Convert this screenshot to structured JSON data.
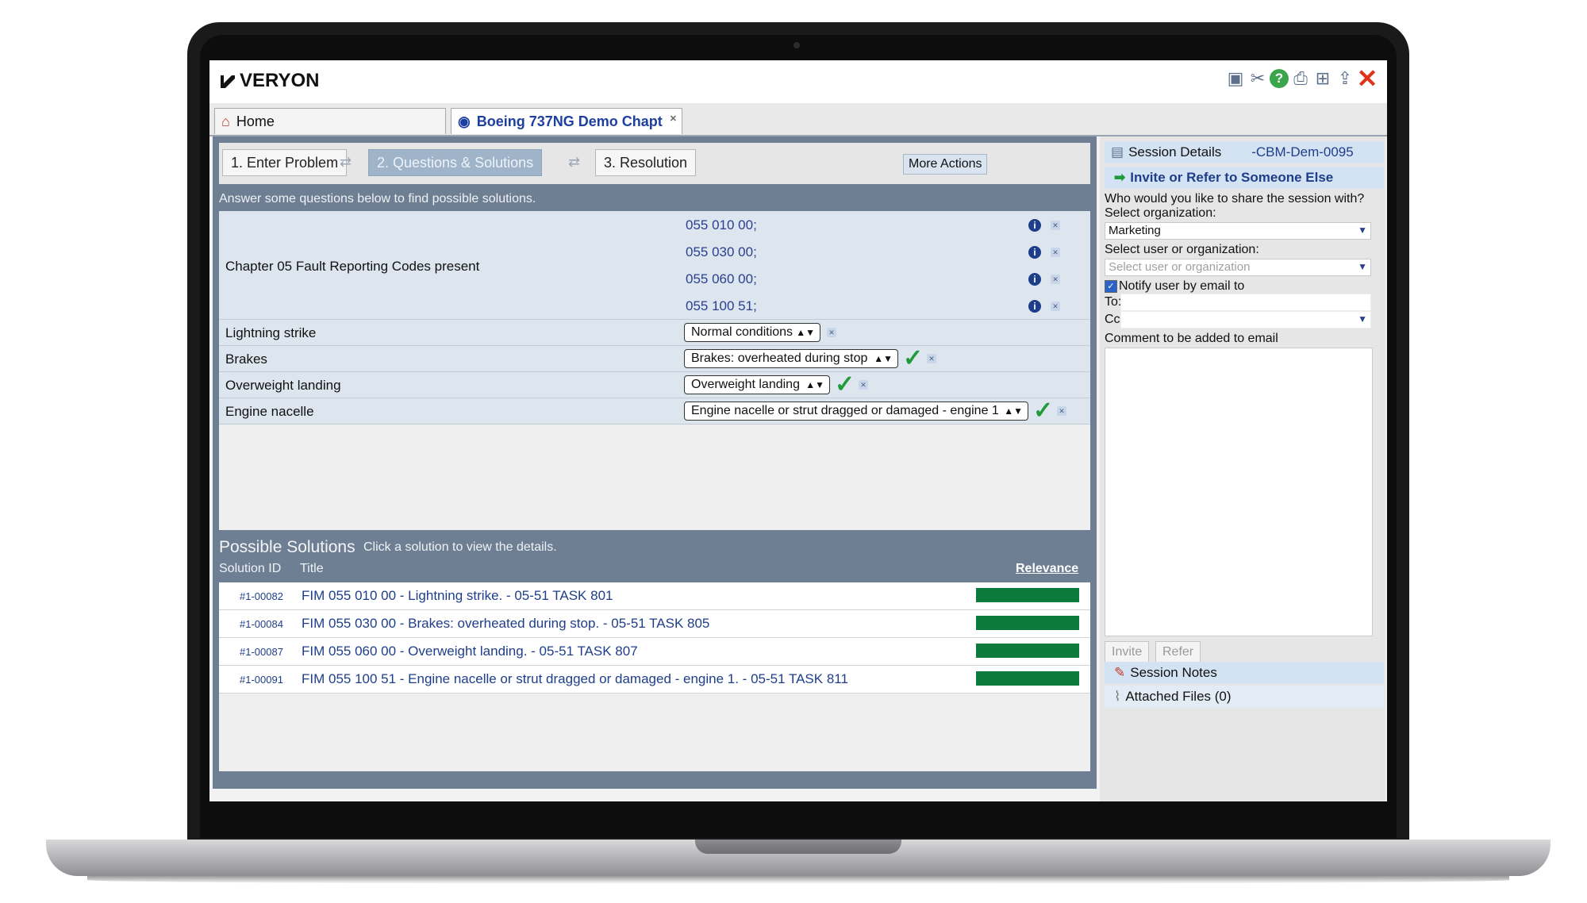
{
  "app": {
    "logo": "VERYON"
  },
  "toolbar": {
    "icons": [
      "monitor-icon",
      "tools-icon",
      "help-icon",
      "print-icon",
      "network-icon",
      "export-icon",
      "close-icon"
    ]
  },
  "tabs": {
    "home": "Home",
    "doc": "Boeing 737NG Demo Chapt"
  },
  "steps": {
    "s1": "1. Enter Problem",
    "s2": "2. Questions & Solutions",
    "s3": "3. Resolution",
    "more": "More Actions"
  },
  "instructions": "Answer some questions below to find possible solutions.",
  "questions": {
    "fault_label": "Chapter 05 Fault Reporting Codes present",
    "codes": [
      "055 010 00;",
      "055 030 00;",
      "055 060 00;",
      "055 100 51;"
    ],
    "rows": [
      {
        "label": "Lightning strike",
        "value": "Normal conditions"
      },
      {
        "label": "Brakes",
        "value": "Brakes: overheated during stop"
      },
      {
        "label": "Overweight landing",
        "value": "Overweight landing"
      },
      {
        "label": "Engine nacelle",
        "value": "Engine nacelle or strut dragged or damaged - engine 1"
      }
    ]
  },
  "solutions": {
    "title": "Possible Solutions",
    "hint": "Click a solution to view the details.",
    "col_id": "Solution ID",
    "col_title": "Title",
    "col_rel": "Relevance",
    "rows": [
      {
        "id": "#1-00082",
        "title": "FIM 055 010 00 - Lightning strike. - 05-51 TASK 801",
        "relevance": 1.0
      },
      {
        "id": "#1-00084",
        "title": "FIM 055 030 00 - Brakes: overheated during stop. - 05-51 TASK 805",
        "relevance": 1.0
      },
      {
        "id": "#1-00087",
        "title": "FIM 055 060 00 - Overweight landing. - 05-51 TASK 807",
        "relevance": 1.0
      },
      {
        "id": "#1-00091",
        "title": "FIM 055 100 51 - Engine nacelle or strut dragged or damaged - engine 1. - 05-51 TASK 811",
        "relevance": 1.0
      }
    ]
  },
  "side": {
    "session_details": "Session Details",
    "session_id": "-CBM-Dem-0095",
    "invite_header": "Invite or Refer to Someone Else",
    "q1": "Who would you like to share the session with?",
    "org_label": "Select organization:",
    "org_value": "Marketing",
    "user_label": "Select user or organization:",
    "user_placeholder": "Select user or organization",
    "notify": "Notify user by email to",
    "to": "To:",
    "cc": "Cc:",
    "comment": "Comment to be added to email",
    "invite_btn": "Invite",
    "refer_btn": "Refer",
    "notes": "Session Notes",
    "files": "Attached Files (0)"
  },
  "colors": {
    "accent": "#1f3e8a",
    "relevance": "#0b7a3a",
    "check": "#1f9b3a"
  }
}
